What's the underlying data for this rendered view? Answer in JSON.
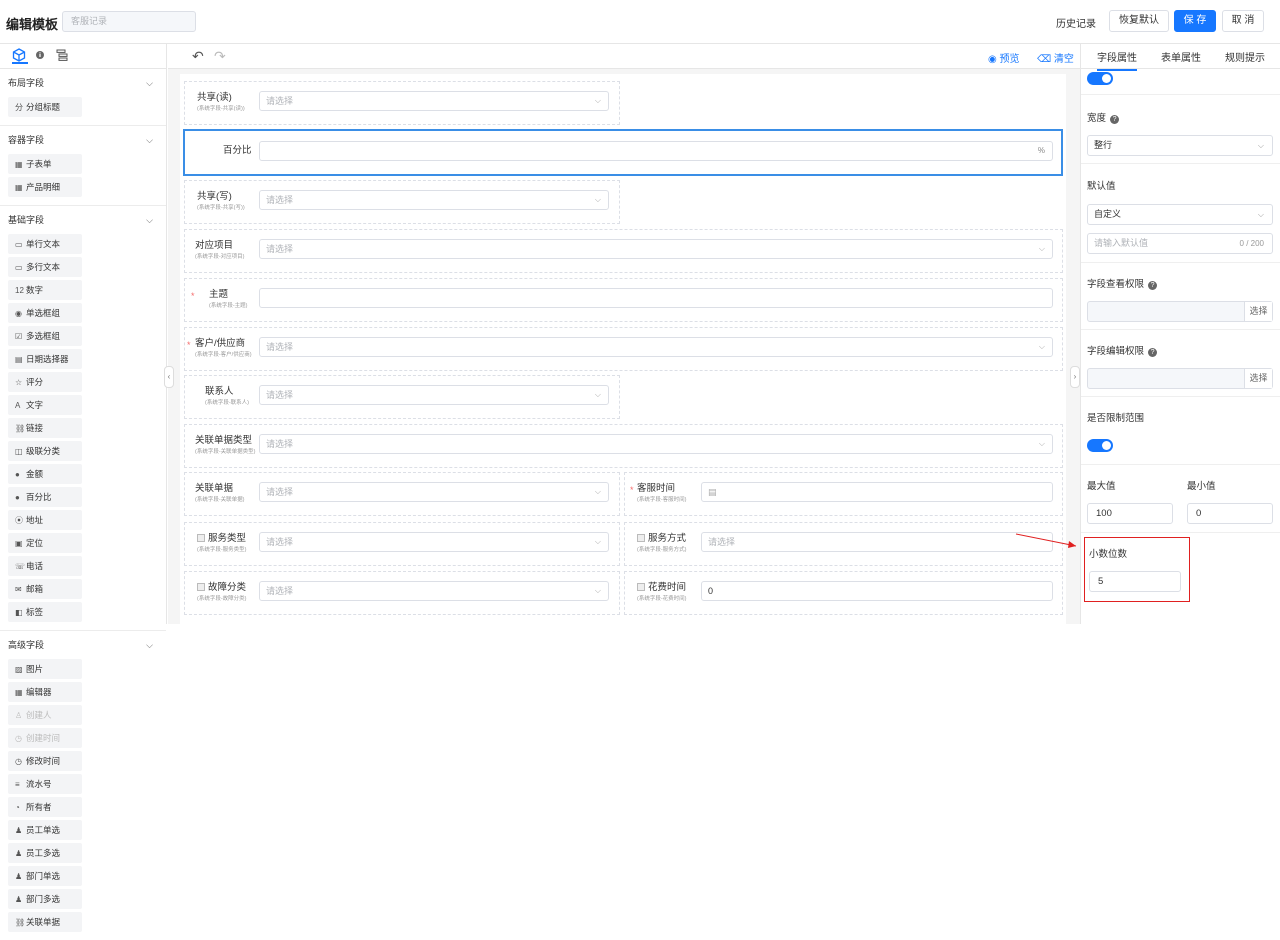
{
  "header": {
    "title": "编辑模板",
    "template_name_placeholder": "客服记录",
    "history": "历史记录",
    "restore": "恢复默认",
    "save": "保 存",
    "cancel": "取 消"
  },
  "left": {
    "sections": [
      {
        "title": "布局字段",
        "items": [
          {
            "icon": "分",
            "label": "分组标题"
          }
        ]
      },
      {
        "title": "容器字段",
        "items": [
          {
            "icon": "▦",
            "label": "子表单"
          },
          {
            "icon": "▦",
            "label": "产品明细"
          }
        ]
      },
      {
        "title": "基础字段",
        "items": [
          {
            "icon": "▭",
            "label": "单行文本"
          },
          {
            "icon": "▭",
            "label": "多行文本"
          },
          {
            "icon": "12",
            "label": "数字"
          },
          {
            "icon": "◉",
            "label": "单选框组"
          },
          {
            "icon": "☑",
            "label": "多选框组"
          },
          {
            "icon": "▤",
            "label": "日期选择器"
          },
          {
            "icon": "☆",
            "label": "评分"
          },
          {
            "icon": "A",
            "label": "文字"
          },
          {
            "icon": "⛓",
            "label": "链接"
          },
          {
            "icon": "◫",
            "label": "级联分类"
          },
          {
            "icon": "●",
            "label": "金额"
          },
          {
            "icon": "●",
            "label": "百分比"
          },
          {
            "icon": "⦿",
            "label": "地址"
          },
          {
            "icon": "▣",
            "label": "定位"
          },
          {
            "icon": "☏",
            "label": "电话"
          },
          {
            "icon": "✉",
            "label": "邮箱"
          },
          {
            "icon": "◧",
            "label": "标签"
          }
        ]
      },
      {
        "title": "高级字段",
        "items": [
          {
            "icon": "▨",
            "label": "图片"
          },
          {
            "icon": "▦",
            "label": "编辑器"
          },
          {
            "icon": "♙",
            "label": "创建人",
            "disabled": true
          },
          {
            "icon": "◷",
            "label": "创建时间",
            "disabled": true
          },
          {
            "icon": "◷",
            "label": "修改时间"
          },
          {
            "icon": "≡",
            "label": "流水号"
          },
          {
            "icon": "◔",
            "label": "所有者"
          },
          {
            "icon": "♟",
            "label": "员工单选"
          },
          {
            "icon": "♟",
            "label": "员工多选"
          },
          {
            "icon": "♟",
            "label": "部门单选"
          },
          {
            "icon": "♟",
            "label": "部门多选"
          },
          {
            "icon": "⛓",
            "label": "关联单据"
          }
        ]
      }
    ]
  },
  "canvas": {
    "preview": "预览",
    "clear": "清空",
    "select_placeholder": "请选择",
    "fields": {
      "share_read": {
        "label": "共享(读)",
        "sub": "(系统字段-共享(读))"
      },
      "percent": {
        "label": "百分比",
        "suffix": "%"
      },
      "share_write": {
        "label": "共享(写)",
        "sub": "(系统字段-共享(写))"
      },
      "project": {
        "label": "对应项目",
        "sub": "(系统字段-对应项目)"
      },
      "subject": {
        "label": "主题",
        "sub": "(系统字段-主题)"
      },
      "customer": {
        "label": "客户/供应商",
        "sub": "(系统字段-客户/供应商)"
      },
      "contact": {
        "label": "联系人",
        "sub": "(系统字段-联系人)"
      },
      "doc_type": {
        "label": "关联单据类型",
        "sub": "(系统字段-关联单据类型)"
      },
      "doc": {
        "label": "关联单据",
        "sub": "(系统字段-关联单据)"
      },
      "service_time": {
        "label": "客服时间",
        "sub": "(系统字段-客服时间)"
      },
      "service_type": {
        "label": "服务类型",
        "sub": "(系统字段-服务类型)"
      },
      "service_mode": {
        "label": "服务方式",
        "sub": "(系统字段-服务方式)"
      },
      "fault_cat": {
        "label": "故障分类",
        "sub": "(系统字段-故障分类)"
      },
      "cost_time": {
        "label": "花费时间",
        "sub": "(系统字段-花费时间)",
        "value": "0"
      }
    }
  },
  "right": {
    "tabs": [
      "字段属性",
      "表单属性",
      "规则提示"
    ],
    "width_label": "宽度",
    "width_value": "整行",
    "default_label": "默认值",
    "default_type": "自定义",
    "default_placeholder": "请输入默认值",
    "default_count": "0 / 200",
    "view_perm": "字段查看权限",
    "edit_perm": "字段编辑权限",
    "choose": "选择",
    "limit_label": "是否限制范围",
    "max_label": "最大值",
    "min_label": "最小值",
    "max_value": "100",
    "min_value": "0",
    "decimal_label": "小数位数",
    "decimal_value": "5"
  }
}
